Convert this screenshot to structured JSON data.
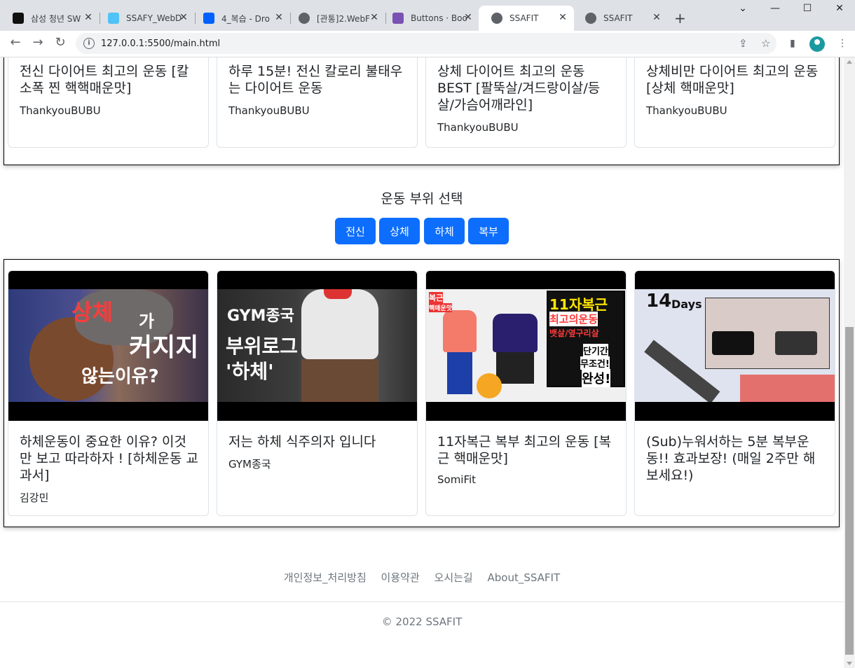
{
  "browser": {
    "tabs": [
      {
        "title": "삼성 청년 SW",
        "favicon": "ssafy-s-icon",
        "favcolor": "#111111",
        "active": false
      },
      {
        "title": "SSAFY_WebD",
        "favicon": "ssafy-doc-icon",
        "favcolor": "#4fc3f7",
        "active": false
      },
      {
        "title": "4_복습 - Dro",
        "favicon": "dropbox-icon",
        "favcolor": "#0061fe",
        "active": false
      },
      {
        "title": "[관통]2.WebF",
        "favicon": "globe-icon",
        "favcolor": "#5f6368",
        "active": false
      },
      {
        "title": "Buttons · Boo",
        "favicon": "bootstrap-icon",
        "favcolor": "#7952b3",
        "active": false
      },
      {
        "title": "SSAFIT",
        "favicon": "globe-icon",
        "favcolor": "#5f6368",
        "active": true
      },
      {
        "title": "SSAFIT",
        "favicon": "globe-icon",
        "favcolor": "#5f6368",
        "active": false
      }
    ],
    "url": "127.0.0.1:5500/main.html"
  },
  "top_section": {
    "cards": [
      {
        "title": "전신 다이어트 최고의 운동 [칼소폭 찐 핵핵매운맛]",
        "channel": "ThankyouBUBU"
      },
      {
        "title": "하루 15분! 전신 칼로리 불태우는 다이어트 운동",
        "channel": "ThankyouBUBU"
      },
      {
        "title": "상체 다이어트 최고의 운동 BEST [팔뚝살/겨드랑이살/등살/가슴어깨라인]",
        "channel": "ThankyouBUBU"
      },
      {
        "title": "상체비만 다이어트 최고의 운동 [상체 핵매운맛]",
        "channel": "ThankyouBUBU"
      }
    ]
  },
  "part_select": {
    "title": "운동 부위 선택",
    "buttons": [
      "전신",
      "상체",
      "하체",
      "복부"
    ],
    "button_color": "#0d6efd"
  },
  "bottom_section": {
    "cards": [
      {
        "title": "하체운동이 중요한 이유? 이것만 보고 따라하자 ! [하체운동 교과서]",
        "channel": "김강민",
        "thumb": {
          "lines": [
            "상체",
            "가",
            "커지지",
            "않는이유?"
          ]
        }
      },
      {
        "title": "저는 하체 식주의자 입니다",
        "channel": "GYM종국",
        "thumb": {
          "lines": [
            "GYM종국",
            "부위로그",
            "'하체'"
          ]
        }
      },
      {
        "title": "11자복근 복부 최고의 운동 [복근 핵매운맛]",
        "channel": "SomiFit",
        "thumb": {
          "lines": [
            "11자복근",
            "최고의운동",
            "뱃살/옆구리살",
            "단기간",
            "무조건!",
            "완성!",
            "복근",
            "핵매운맛"
          ]
        }
      },
      {
        "title": "(Sub)누워서하는 5분 복부운동!! 효과보장! (매일 2주만 해보세요!)",
        "channel": "",
        "thumb": {
          "lines": [
            "14",
            "Days"
          ]
        }
      }
    ]
  },
  "footer": {
    "links": [
      "개인정보_처리방침",
      "이용약관",
      "오시는길",
      "About_SSAFIT"
    ],
    "copyright": "© 2022 SSAFIT"
  }
}
